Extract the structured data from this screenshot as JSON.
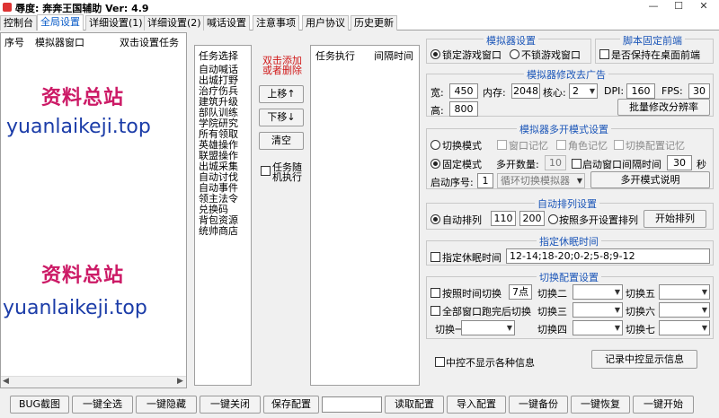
{
  "window": {
    "title": "奔奔王国辅助 Ver: 4.9",
    "title_prefix": "辱度:",
    "controls": {
      "minimize": "—",
      "maximize": "☐",
      "close": "✕"
    }
  },
  "tabs": [
    "控制台",
    "全局设置",
    "详细设置(1)",
    "详细设置(2)",
    "喊话设置",
    "注意事项",
    "用户协议",
    "历史更新"
  ],
  "left_panel": {
    "headers": [
      "序号",
      "模拟器窗口",
      "双击设置任务"
    ]
  },
  "watermark": {
    "cn": "资料总站",
    "en": "yuanlaikeji.top"
  },
  "task_select": {
    "header": "任务选择",
    "items": [
      "自动喊话",
      "出城打野",
      "治疗伤兵",
      "建筑升级",
      "部队训练",
      "学院研究",
      "所有领取",
      "英雄操作",
      "联盟操作",
      "出城采集",
      "自动讨伐",
      "自动事件",
      "领主法令",
      "兑换码",
      "背包资源",
      "统帅商店"
    ]
  },
  "middle_controls": {
    "hint": [
      "双击添加",
      "或者删除"
    ],
    "move_up": "上移↑",
    "move_down": "下移↓",
    "clear": "清空",
    "random_label": [
      "任务随",
      "机执行"
    ]
  },
  "task_exec": {
    "headers": [
      "任务执行",
      "间隔时间"
    ]
  },
  "emulator_settings": {
    "title": "模拟器设置",
    "lock_window": "锁定游戏窗口",
    "unlock_window": "不锁游戏窗口"
  },
  "script_front": {
    "title": "脚本固定前端",
    "keep_front": "是否保持在桌面前端"
  },
  "emulator_ads": {
    "title": "模拟器修改去广告",
    "width_label": "宽:",
    "width_value": "450",
    "memory_label": "内存:",
    "memory_value": "2048",
    "cores_label": "核心:",
    "cores_value": "2",
    "dpi_label": "DPI:",
    "dpi_value": "160",
    "fps_label": "FPS:",
    "fps_value": "30",
    "height_label": "高:",
    "height_value": "800",
    "batch_button": "批量修改分辨率"
  },
  "multi_open": {
    "title": "模拟器多开模式设置",
    "switch_mode": "切换模式",
    "window_memory": "窗口记忆",
    "role_memory": "角色记忆",
    "switch_config_memory": "切换配置记忆",
    "fixed_mode": "固定模式",
    "multi_count_label": "多开数量:",
    "multi_count_value": "10",
    "launch_interval": "启动窗口间隔时间",
    "interval_value": "30",
    "interval_unit": "秒",
    "launch_order_label": "启动序号:",
    "launch_order_value": "1",
    "loop_select": "循环切换模拟器",
    "explain_button": "多开模式说明"
  },
  "auto_arrange": {
    "title": "自动排列设置",
    "auto_label": "自动排列",
    "x_value": "110",
    "y_value": "200",
    "by_multi": "按照多开设置排列",
    "start_button": "开始排列"
  },
  "sleep": {
    "title": "指定休眠时间",
    "label": "指定休眠时间",
    "value": "12-14;18-20;0-2;5-8;9-12"
  },
  "switch_config": {
    "title": "切换配置设置",
    "by_time": "按照时间切换",
    "time_value": "7点",
    "all_done": "全部窗口跑完后切换",
    "switch1": "切换一",
    "switch2": "切换二",
    "switch3": "切换三",
    "switch4": "切换四",
    "switch5": "切换五",
    "switch6": "切换六",
    "switch7": "切换七"
  },
  "central_info": {
    "hide_label": "中控不显示各种信息",
    "record_button": "记录中控显示信息"
  },
  "bottom_buttons": {
    "bug": "BUG截图",
    "select_all": "一键全选",
    "hide": "一键隐藏",
    "close": "一键关闭",
    "save": "保存配置",
    "config_name": "",
    "read": "读取配置",
    "import": "导入配置",
    "backup": "一键备份",
    "restore": "一键恢复",
    "start": "一键开始"
  }
}
